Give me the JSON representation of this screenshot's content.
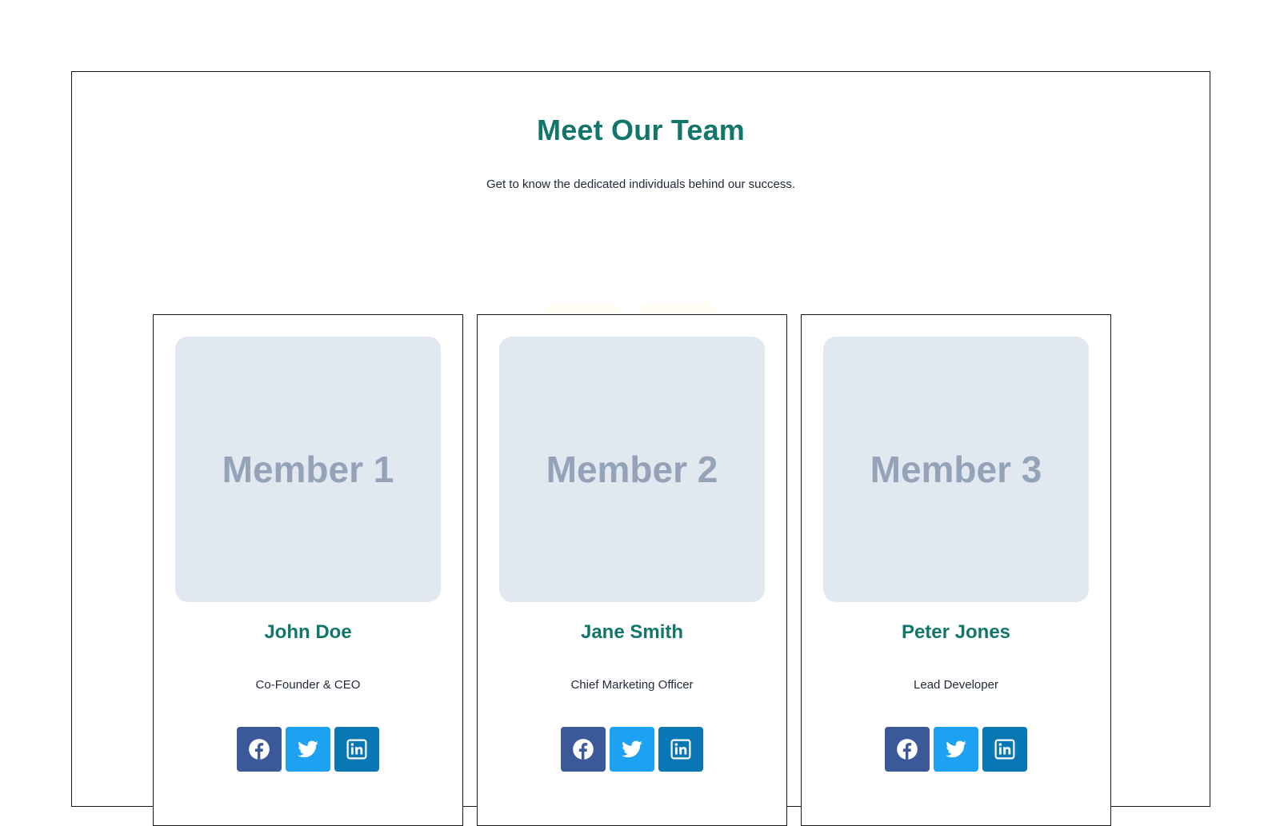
{
  "section": {
    "title": "Meet Our Team",
    "subtitle": "Get to know the dedicated individuals behind our success."
  },
  "members": [
    {
      "photo_label": "Member 1",
      "name": "John Doe",
      "role": "Co-Founder & CEO",
      "socials": [
        "facebook-icon",
        "twitter-icon",
        "linkedin-icon"
      ]
    },
    {
      "photo_label": "Member 2",
      "name": "Jane Smith",
      "role": "Chief Marketing Officer",
      "socials": [
        "facebook-icon",
        "twitter-icon",
        "linkedin-icon"
      ]
    },
    {
      "photo_label": "Member 3",
      "name": "Peter Jones",
      "role": "Lead Developer",
      "socials": [
        "facebook-icon",
        "twitter-icon",
        "linkedin-icon"
      ]
    }
  ],
  "colors": {
    "accent": "#12776a",
    "facebook": "#3b5998",
    "twitter": "#1da1f2",
    "linkedin": "#0a77b5",
    "photo_placeholder": "#e2e8f0",
    "photo_text": "#94a3b8"
  }
}
